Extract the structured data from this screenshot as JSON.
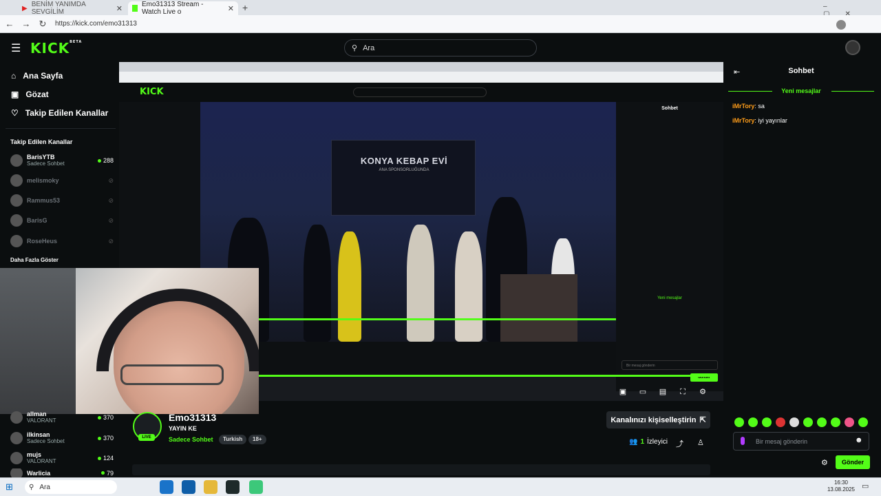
{
  "browser": {
    "tabs": [
      {
        "title": "BENİM YANIMDA SEVGİLİM",
        "active": false
      },
      {
        "title": "Emo31313 Stream - Watch Live o",
        "active": true
      }
    ],
    "url": "https://kick.com/emo31313"
  },
  "kick": {
    "logo": "KICK",
    "logo_badge": "BETA",
    "search_placeholder": "Ara",
    "nav": [
      {
        "label": "Ana Sayfa",
        "icon": "home-icon"
      },
      {
        "label": "Gözat",
        "icon": "browse-icon"
      },
      {
        "label": "Takip Edilen Kanallar",
        "icon": "heart-icon"
      }
    ],
    "followed_heading": "Takip Edilen Kanallar",
    "followed": [
      {
        "name": "BarisYTB",
        "sub": "Sadece Sohbet",
        "count": "288",
        "live": true
      },
      {
        "name": "melismoky",
        "sub": "",
        "count": "",
        "live": false
      },
      {
        "name": "Rammus53",
        "sub": "",
        "count": "",
        "live": false
      },
      {
        "name": "BarisG",
        "sub": "",
        "count": "",
        "live": false
      },
      {
        "name": "RoseHeus",
        "sub": "",
        "count": "",
        "live": false
      }
    ],
    "show_more": "Daha Fazla Göster",
    "recommended": [
      {
        "name": "allman",
        "sub": "VALORANT",
        "count": "370"
      },
      {
        "name": "ilkinsan",
        "sub": "Sadece Sohbet",
        "count": "370"
      },
      {
        "name": "mujs",
        "sub": "VALORANT",
        "count": "124"
      },
      {
        "name": "Warlicia",
        "sub": "",
        "count": "79"
      }
    ]
  },
  "stream": {
    "banner_title": "KONYA KEBAP EVİ",
    "banner_sub": "ANA SPONSORLUĞUNDA",
    "streamer": "Emo31313",
    "live_badge": "LIVE",
    "title": "YAYIN KE",
    "category": "Sadece Sohbet",
    "tags": [
      "Turkish",
      "18+"
    ],
    "customize_label": "Kanalınızı kişiselleştirin",
    "viewers_count": "1",
    "viewers_label": "İzleyici"
  },
  "chat": {
    "title": "Sohbet",
    "new_messages": "Yeni mesajlar",
    "messages": [
      {
        "user": "iMrTory",
        "text": "sa"
      },
      {
        "user": "iMrTory",
        "text": "iyi yayınlar"
      }
    ],
    "input_placeholder": "Bir mesaj gönderin",
    "send_label": "Gönder"
  },
  "taskbar": {
    "search": "Ara",
    "time": "16:30",
    "date": "13.08.2025"
  },
  "colors": {
    "accent": "#53fc18",
    "chat_user": "#ff9d1a"
  }
}
